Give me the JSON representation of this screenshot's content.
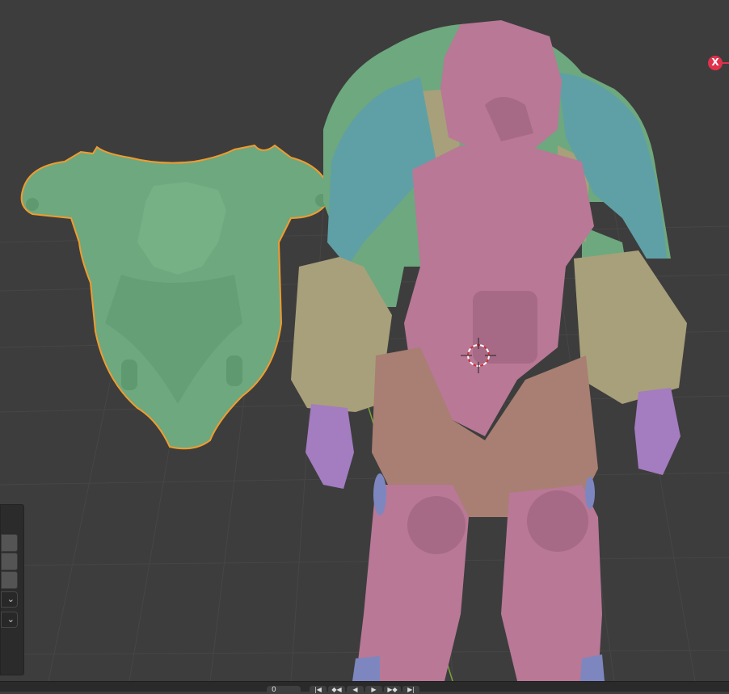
{
  "viewport": {
    "background_color": "#3d3d3d",
    "selection_outline_color": "#f29b2e",
    "material_colors": {
      "green": "#6ea87e",
      "magenta": "#b87896",
      "teal": "#5fa0a6",
      "tan": "#a8a07a",
      "violet": "#a47cc0",
      "blue": "#7e86c0"
    }
  },
  "axis_gizmo": {
    "label": "X",
    "color": "#e0314b"
  },
  "side_panel": {
    "fields": [
      "",
      "",
      ""
    ],
    "dropdowns": [
      {
        "icon": "chevron-down-icon",
        "glyph": "⌄"
      },
      {
        "icon": "chevron-down-icon",
        "glyph": "⌄"
      }
    ]
  },
  "timeline": {
    "current_frame": "0",
    "playback_buttons": [
      {
        "icon": "jump-start-icon",
        "glyph": "|◀"
      },
      {
        "icon": "prev-keyframe-icon",
        "glyph": "◆◀"
      },
      {
        "icon": "play-reverse-icon",
        "glyph": "◀"
      },
      {
        "icon": "play-icon",
        "glyph": "▶"
      },
      {
        "icon": "next-keyframe-icon",
        "glyph": "▶◆"
      },
      {
        "icon": "jump-end-icon",
        "glyph": "▶|"
      }
    ]
  }
}
